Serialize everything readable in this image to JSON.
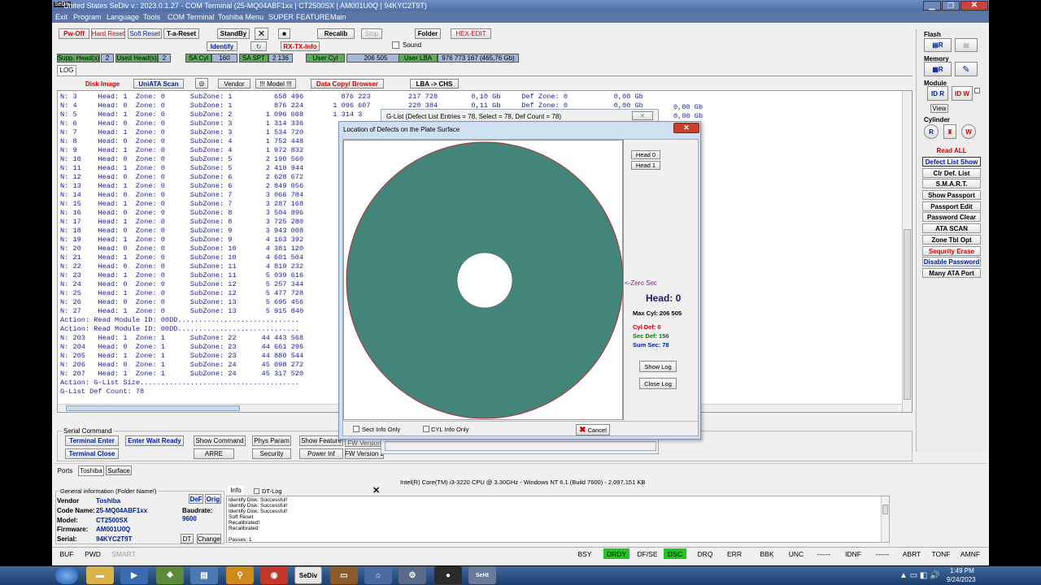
{
  "titlebar": {
    "app_icon": "SeDiv",
    "title": "United States  SeDiv v.: 2023.0.1.27 - COM Terminal  (25-MQ04ABF1xx | CT2500SX | AM001U0Q | 94KYC2T9T)"
  },
  "menu": [
    "Exit",
    "Program",
    "Language",
    "Tools",
    "COM Terminal",
    "Toshiba Menu",
    "SUPER",
    "FEATURE",
    "Main"
  ],
  "toolbar": {
    "pw_off": "Pw-Off",
    "hard_reset": "Hard Reset",
    "soft_reset": "Soft Reset",
    "t_a_reset": "T-a-Reset",
    "standby": "StandBy",
    "identify": "Identify",
    "rx_tx": "RX-TX-Info",
    "recalib": "Recalib",
    "stop": "Stop",
    "folder": "Folder",
    "hex_edit": "HEX-EDIT",
    "sound": "Sound"
  },
  "info_row": {
    "supp_heads_label": "Supp. Head(s)",
    "supp_heads": "2",
    "used_heads_label": "Used Head(s)",
    "used_heads": "2",
    "sa_cyl_label": "SA Cyl",
    "sa_cyl": "160",
    "sa_spt_label": "SA SPT",
    "sa_spt": "2 136",
    "user_cyl_label": "User Cyl",
    "user_cyl": "206 505",
    "user_lba_label": "User LBA",
    "user_lba": "976 773 167  (465,76 Gb)"
  },
  "log_tab": "LOG",
  "subtoolbar": [
    "Disk Image",
    "UniATA Scan",
    "Vendor",
    "!!! Model !!!",
    "Data Copy/ Browser",
    "LBA -> CHS"
  ],
  "log_lines": [
    "N: 3     Head: 1  Zone: 0      SubZone: 1          658 496         876 223         217 728        0,10 Gb     Def Zone: 0           0,00 Gb",
    "N: 4     Head: 0  Zone: 0      SubZone: 1          876 224       1 096 607         220 384        0,11 Gb     Def Zone: 0           0,00 Gb",
    "N: 5     Head: 1  Zone: 0      SubZone: 2        1 096 608       1 314 3",
    "N: 6     Head: 0  Zone: 0      SubZone: 3        1 314 336",
    "N: 7     Head: 1  Zone: 0      SubZone: 3        1 534 720",
    "N: 8     Head: 0  Zone: 0      SubZone: 4        1 752 448",
    "N: 9     Head: 1  Zone: 0      SubZone: 4        1 972 832",
    "N: 10    Head: 0  Zone: 0      SubZone: 5        2 190 560",
    "N: 11    Head: 1  Zone: 0      SubZone: 5        2 410 944",
    "N: 12    Head: 0  Zone: 0      SubZone: 6        2 628 672",
    "N: 13    Head: 1  Zone: 0      SubZone: 6        2 849 056",
    "N: 14    Head: 0  Zone: 0      SubZone: 7        3 066 784",
    "N: 15    Head: 1  Zone: 0      SubZone: 7        3 287 168",
    "N: 16    Head: 0  Zone: 0      SubZone: 8        3 504 896",
    "N: 17    Head: 1  Zone: 0      SubZone: 8        3 725 280",
    "N: 18    Head: 0  Zone: 0      SubZone: 9        3 943 008",
    "N: 19    Head: 1  Zone: 0      SubZone: 9        4 163 392",
    "N: 20    Head: 0  Zone: 0      SubZone: 10       4 381 120",
    "N: 21    Head: 1  Zone: 0      SubZone: 10       4 601 504",
    "N: 22    Head: 0  Zone: 0      SubZone: 11       4 819 232",
    "N: 23    Head: 1  Zone: 0      SubZone: 11       5 039 616",
    "N: 24    Head: 0  Zone: 0      SubZone: 12       5 257 344",
    "N: 25    Head: 1  Zone: 0      SubZone: 12       5 477 728",
    "N: 26    Head: 0  Zone: 0      SubZone: 13       5 695 456",
    "N: 27    Head: 1  Zone: 0      SubZone: 13       5 915 840",
    "Action: Read Module ID: 00DD.............................",
    "Action: Read Module ID: 00DD.............................",
    "N: 203   Head: 1  Zone: 1      SubZone: 22      44 443 568",
    "N: 204   Head: 0  Zone: 1      SubZone: 23      44 661 296",
    "N: 205   Head: 1  Zone: 1      SubZone: 23      44 880 544",
    "N: 206   Head: 0  Zone: 1      SubZone: 24      45 098 272",
    "N: 207   Head: 1  Zone: 1      SubZone: 24      45 317 520",
    "Action: G-List Size......................................",
    "G-List Def Count: 78"
  ],
  "right_tail": [
    "0,00 Gb",
    "0,00 Gb",
    "0,00 Gb"
  ],
  "right_panel": {
    "flash": "Flash",
    "memory": "Memory",
    "module": "Module",
    "view": "View",
    "cylinder": "Cylinder",
    "buttons": [
      "Read ALL",
      "Defect List Show",
      "Clr Def. List",
      "S.M.A.R.T.",
      "Show Passport",
      "Passport Edit",
      "Password Clear",
      "ATA SCAN",
      "Zone Tbl Opt",
      "Sequrity Erase",
      "Disable Password",
      "Many ATA Port"
    ]
  },
  "glist_dialog": {
    "title": "G-List (Defect List Entries = 78, Select = 78, Def Count = 78)"
  },
  "plate_dialog": {
    "title": "Location of Defects on the Plate Surface",
    "head0": "Head 0",
    "head1": "Head 1",
    "zero_sec": "<-Zero Sec",
    "head_label": "Head: 0",
    "max_cyl": "Max Cyl: 206 505",
    "cyl_def": "Cyl Def: 0",
    "sec_def": "Sec Def: 156",
    "sum_sec": "Sum Sec: 78",
    "show_log": "Show Log",
    "close_log": "Close Log",
    "sect_info": "Sect Info Only",
    "cyl_info": "CYL Info Only",
    "cancel": "Cancel",
    "disk_color": "#44857b"
  },
  "serial": {
    "group": "Serial Command",
    "terminal_enter": "Terminal Enter",
    "enter_wait": "Enter Wait Ready",
    "terminal_close": "Terminal Close",
    "show_command": "Show Command",
    "arre": "ARRE",
    "phys_param": "Phys Param",
    "security": "Security",
    "show_feature": "Show Feature",
    "power_inf": "Power Inf",
    "fw_version": "FW Version 2",
    "fw_version_top": "FW Version"
  },
  "bottom_tabs": [
    "Ports",
    "Toshiba",
    "Surface"
  ],
  "cpu_info": "Intel(R) Core(TM) i3-3220 CPU @ 3.30GHz - Windows NT 6.1 (Build 7600) - 2,097,151 KB",
  "general": {
    "group": "General information (Folder Name!)",
    "vendor_label": "Vendor",
    "vendor": "Toshiba",
    "code_label": "Code Name:",
    "code": "25-MQ04ABF1xx",
    "model_label": "Model:",
    "model": "CT2500SX",
    "fw_label": "Firmware:",
    "fw": "AM001U0Q",
    "serial_label": "Serial:",
    "serial": "94KYC2T9T",
    "def": "DeF",
    "orig": "Orig",
    "baud_label": "Baudrate:",
    "baud": "9600",
    "dt": "DT",
    "change": "Change"
  },
  "info_box": {
    "tab": "Info",
    "dt_log": "DT-Log",
    "lines": [
      "Identify Disk: Successful!",
      "Identify Disk: Successful!",
      "Identify Disk: Successful!",
      "Soft Reset",
      "Recalibrated!",
      "Recalibrated",
      "",
      "Passes: 1"
    ]
  },
  "statusbar": {
    "left": [
      "BUF",
      "PWD",
      "SMART"
    ],
    "right": [
      "BSY",
      "DRDY",
      "DF/SE",
      "DSC",
      "DRQ",
      "ERR",
      "BBK",
      "UNC",
      "------",
      "IDNF",
      "------",
      "ABRT",
      "TONF",
      "AMNF"
    ]
  },
  "taskbar": {
    "time": "1:49 PM",
    "date": "9/24/2023",
    "sediv": "SeDiv"
  }
}
